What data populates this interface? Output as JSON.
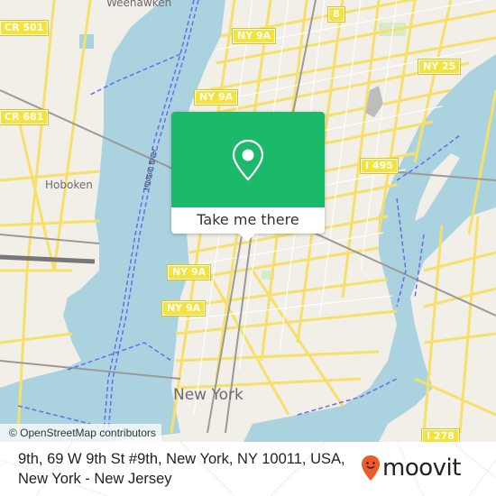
{
  "map": {
    "place_labels": {
      "weehawken": "Weehawken",
      "hoboken": "Hoboken",
      "new_york": "New York"
    },
    "river_label": "Hudson River",
    "road_shields": [
      {
        "id": "cr501",
        "label": "CR 501"
      },
      {
        "id": "cr681",
        "label": "CR 681"
      },
      {
        "id": "ny9a_1",
        "label": "NY 9A"
      },
      {
        "id": "ny9a_2",
        "label": "NY 9A"
      },
      {
        "id": "ny9a_3",
        "label": "NY 9A"
      },
      {
        "id": "ny9a_4",
        "label": "NY 9A"
      },
      {
        "id": "ny25",
        "label": "NY 25"
      },
      {
        "id": "i495",
        "label": "I 495"
      },
      {
        "id": "r8",
        "label": "8"
      },
      {
        "id": "i278",
        "label": "I 278"
      }
    ],
    "attribution": "© OpenStreetMap contributors",
    "colors": {
      "water": "#aad3df",
      "land": "#f2efe9",
      "road": "#f7e06a",
      "ferry": "#6a6af0"
    }
  },
  "popup": {
    "icon": "map-pin-icon",
    "cta_label": "Take me there",
    "color": "#1db96b"
  },
  "footer": {
    "address_line1": "9th, 69 W 9th St #9th, New York, NY 10011, USA,",
    "address_line2": "New York - New Jersey",
    "brand": "moovit",
    "brand_color": "#f05a28"
  }
}
